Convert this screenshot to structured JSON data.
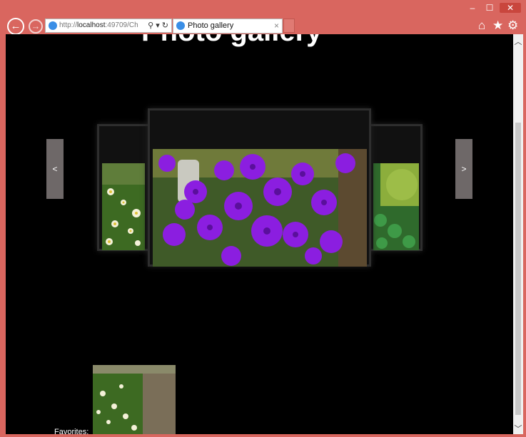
{
  "window": {
    "minimize_glyph": "–",
    "maximize_glyph": "☐",
    "close_glyph": "✕"
  },
  "browser": {
    "back_glyph": "←",
    "forward_glyph": "→",
    "address": {
      "scheme": "http://",
      "host": "localhost",
      "rest": ":49709/Ch"
    },
    "address_tools": "⚲ ▾ ↻",
    "tab": {
      "label": "Photo gallery",
      "close_glyph": "×"
    },
    "toolbar_icons": {
      "home": "⌂",
      "favorites": "★",
      "tools": "⚙"
    }
  },
  "page": {
    "title": "Photo gallery",
    "carousel": {
      "prev_label": "<",
      "next_label": ">"
    },
    "favorites_label": "Favorites:"
  },
  "colors": {
    "chrome": "#d9665f",
    "content_bg": "#000000",
    "arrow_bg": "#6e6868"
  }
}
